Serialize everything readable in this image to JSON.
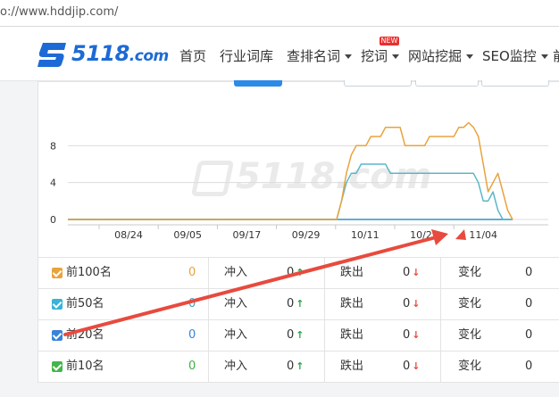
{
  "browser": {
    "url": "o://www.hddjip.com/"
  },
  "brand": {
    "logo_text": "5118",
    "logo_suffix": ".com"
  },
  "nav": {
    "items": [
      {
        "label": "首页",
        "dropdown": false
      },
      {
        "label": "行业词库",
        "dropdown": false
      },
      {
        "label": "查排名词",
        "dropdown": true
      },
      {
        "label": "挖词",
        "dropdown": true,
        "badge": "NEW"
      },
      {
        "label": "网站挖掘",
        "dropdown": true
      },
      {
        "label": "SEO监控",
        "dropdown": true
      },
      {
        "label": "前",
        "dropdown": false
      }
    ]
  },
  "watermark": {
    "text": "5118.com"
  },
  "chart_data": {
    "type": "line",
    "x_tick_labels": [
      "08/24",
      "09/05",
      "09/17",
      "09/29",
      "10/11",
      "10/23",
      "11/04"
    ],
    "y_tick_labels": [
      "0",
      "4",
      "8"
    ],
    "ylim": [
      0,
      12
    ],
    "grid": true,
    "legend": "none",
    "series": [
      {
        "color": "#e8a33d",
        "x": [
          0,
          55,
          56,
          57,
          58,
          59,
          60,
          61,
          62,
          63,
          64,
          65,
          66,
          67,
          68,
          69,
          70,
          71,
          72,
          73,
          74,
          75,
          76,
          77,
          78,
          79,
          80,
          81,
          82,
          83,
          84,
          85,
          86,
          87,
          88,
          89,
          90,
          91
        ],
        "y": [
          0,
          0,
          2,
          5,
          7,
          8,
          8,
          8,
          9,
          9,
          9,
          10,
          10,
          10,
          10,
          8,
          8,
          8,
          8,
          8,
          9,
          9,
          9,
          9,
          9,
          9,
          10,
          10,
          10.5,
          10,
          9,
          6,
          3,
          4,
          5,
          3,
          1,
          0
        ]
      },
      {
        "color": "#5bb6c9",
        "x": [
          0,
          55,
          56,
          57,
          58,
          59,
          60,
          61,
          62,
          63,
          64,
          65,
          66,
          67,
          68,
          69,
          70,
          71,
          72,
          73,
          74,
          75,
          76,
          77,
          78,
          79,
          80,
          81,
          82,
          83,
          84,
          85,
          86,
          87,
          88,
          89,
          90,
          91
        ],
        "y": [
          0,
          0,
          2,
          4,
          5,
          5,
          6,
          6,
          6,
          6,
          6,
          6,
          5,
          5,
          5,
          5,
          5,
          5,
          5,
          5,
          5,
          5,
          5,
          5,
          5,
          5,
          5,
          5,
          5,
          5,
          4,
          2,
          2,
          3,
          1,
          0,
          0,
          0
        ]
      },
      {
        "color": "#4aa0e0",
        "x": [
          0,
          91
        ],
        "y": [
          0,
          0
        ]
      },
      {
        "color": "#5cb85c",
        "x": [
          0,
          91
        ],
        "y": [
          0,
          0
        ]
      }
    ]
  },
  "table": {
    "rows": [
      {
        "label": "前100名",
        "count": "0",
        "count_color": "#e8a33d",
        "chk_color": "#e8a33d",
        "in_label": "冲入",
        "in_val": "0",
        "out_label": "跌出",
        "out_val": "0",
        "change_label": "变化",
        "change_val": "0"
      },
      {
        "label": "前50名",
        "count": "0",
        "count_color": "#3aa0c9",
        "chk_color": "#39b3d7",
        "in_label": "冲入",
        "in_val": "0",
        "out_label": "跌出",
        "out_val": "0",
        "change_label": "变化",
        "change_val": "0"
      },
      {
        "label": "前20名",
        "count": "0",
        "count_color": "#3a86d0",
        "chk_color": "#3b82d8",
        "in_label": "冲入",
        "in_val": "0",
        "out_label": "跌出",
        "out_val": "0",
        "change_label": "变化",
        "change_val": "0"
      },
      {
        "label": "前10名",
        "count": "0",
        "count_color": "#3fae49",
        "chk_color": "#43b54a",
        "in_label": "冲入",
        "in_val": "0",
        "out_label": "跌出",
        "out_val": "0",
        "change_label": "变化",
        "change_val": "0"
      }
    ],
    "up_icon": "↑",
    "down_icon": "↓"
  },
  "annotation": {
    "color": "#e84a3e",
    "icon": "red-arrow-annotation"
  }
}
